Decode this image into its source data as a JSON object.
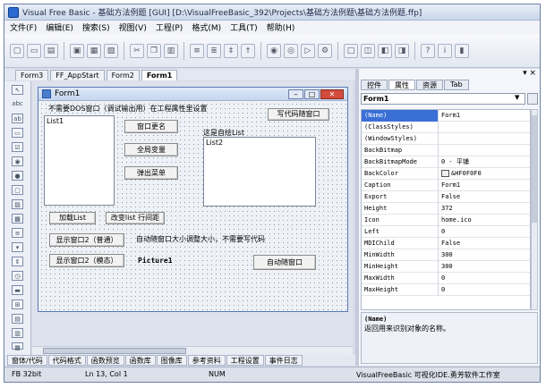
{
  "app": {
    "title": "Visual Free Basic - 基础方法例题 [GUI]  [D:\\VisualFreeBasic_392\\Projects\\基础方法例题\\基础方法例题.ffp]"
  },
  "menu": [
    "文件(F)",
    "编辑(E)",
    "搜索(S)",
    "视图(V)",
    "工程(P)",
    "格式(M)",
    "工具(T)",
    "帮助(H)"
  ],
  "editor_tabs": [
    {
      "label": "Form3",
      "active": false
    },
    {
      "label": "FF_AppStart",
      "active": false
    },
    {
      "label": "Form2",
      "active": false
    },
    {
      "label": "Form1",
      "active": true
    }
  ],
  "close_glyph": "▾ ×",
  "toolbox_label": "abc",
  "form": {
    "title": "Form1",
    "top_label": "不需要DOS窗口（调试输出用）在工程属性里设置",
    "btn_write_code": "写代码随窗口",
    "list1_label": "List1",
    "btn_window_name": "窗口更名",
    "btn_global_var": "全局变量",
    "btn_popup_menu": "弹出菜单",
    "self_list_label": "这是自绘List",
    "list2_label": "List2",
    "btn_load_list": "加载List",
    "btn_change_list": "改变list 行间距",
    "btn_show2_normal": "显示窗口2（普通）",
    "auto_size_label": "自动随窗口大小调整大小，不需要写代码",
    "btn_show2_modal": "显示窗口2（模态）",
    "picture_label": "Picture1",
    "btn_auto_window": "自动随窗口"
  },
  "bottom_tabs": [
    "窗体/代码",
    "代码格式",
    "函数预览",
    "函数库",
    "图像库",
    "参考资料",
    "工程设置",
    "事件日志"
  ],
  "status": {
    "bits": "FB 32bit",
    "position": "Ln 13,  Col 1",
    "num": "NUM",
    "company": "VisualFreeBasic 可视化IDE.勇芳软件工作室"
  },
  "right_panel": {
    "tabs": [
      {
        "label": "控件",
        "active": false
      },
      {
        "label": "属性",
        "active": true
      },
      {
        "label": "资源",
        "active": false
      },
      {
        "label": "Tab",
        "active": false
      }
    ],
    "pin": "▾ ×",
    "object": "Form1",
    "properties": [
      {
        "name": "(Name)",
        "value": "Form1",
        "selected": true
      },
      {
        "name": "(ClassStyles)",
        "value": ""
      },
      {
        "name": "(WindowStyles)",
        "value": ""
      },
      {
        "name": "BackBitmap",
        "value": ""
      },
      {
        "name": "BackBitmapMode",
        "value": "0 - 平铺"
      },
      {
        "name": "BackColor",
        "value": "&HF0F0F0",
        "swatch": "#f0f0f0"
      },
      {
        "name": "Caption",
        "value": "Form1"
      },
      {
        "name": "Export",
        "value": "False"
      },
      {
        "name": "Height",
        "value": "372"
      },
      {
        "name": "Icon",
        "value": "home.ico"
      },
      {
        "name": "Left",
        "value": "0"
      },
      {
        "name": "MDIChild",
        "value": "False"
      },
      {
        "name": "MinWidth",
        "value": "300"
      },
      {
        "name": "MinHeight",
        "value": "300"
      },
      {
        "name": "MaxWidth",
        "value": "0"
      },
      {
        "name": "MaxHeight",
        "value": "0"
      }
    ],
    "desc_name": "(Name)",
    "desc_text": "返回用来识别对象的名称。"
  }
}
